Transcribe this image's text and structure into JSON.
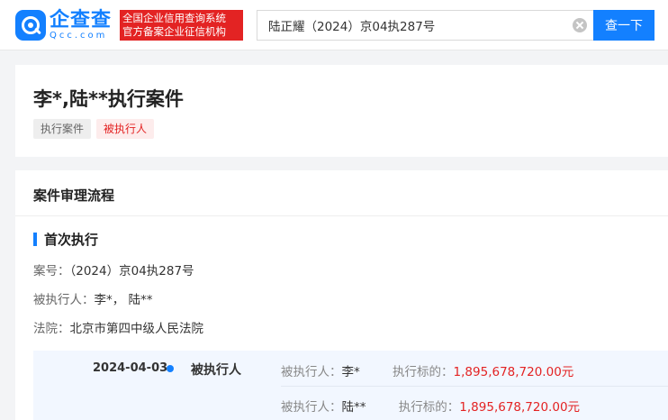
{
  "header": {
    "logo_cn": "企查查",
    "logo_en": "Qcc.com",
    "badge_line1": "全国企业信用查询系统",
    "badge_line2": "官方备案企业征信机构",
    "search_value": "陆正耀（2024）京04执287号",
    "search_button": "查一下"
  },
  "case": {
    "title": "李*,陆**执行案件",
    "tags": [
      "执行案件",
      "被执行人"
    ]
  },
  "process": {
    "section_title": "案件审理流程",
    "stage_title": "首次执行",
    "case_no_label": "案号：",
    "case_no": "（2024）京04执287号",
    "executed_label": "被执行人：",
    "executed": "李*， 陆**",
    "court_label": "法院：",
    "court": "北京市第四中级人民法院",
    "timeline": {
      "date": "2024-04-03",
      "role": "被执行人",
      "rows": [
        {
          "person_label": "被执行人：",
          "person": "李*",
          "amount_label": "执行标的：",
          "amount": "1,895,678,720.00元"
        },
        {
          "person_label": "被执行人：",
          "person": "陆**",
          "amount_label": "执行标的：",
          "amount": "1,895,678,720.00元"
        }
      ]
    }
  },
  "colors": {
    "brand": "#1380ff",
    "alert": "#e32323"
  }
}
